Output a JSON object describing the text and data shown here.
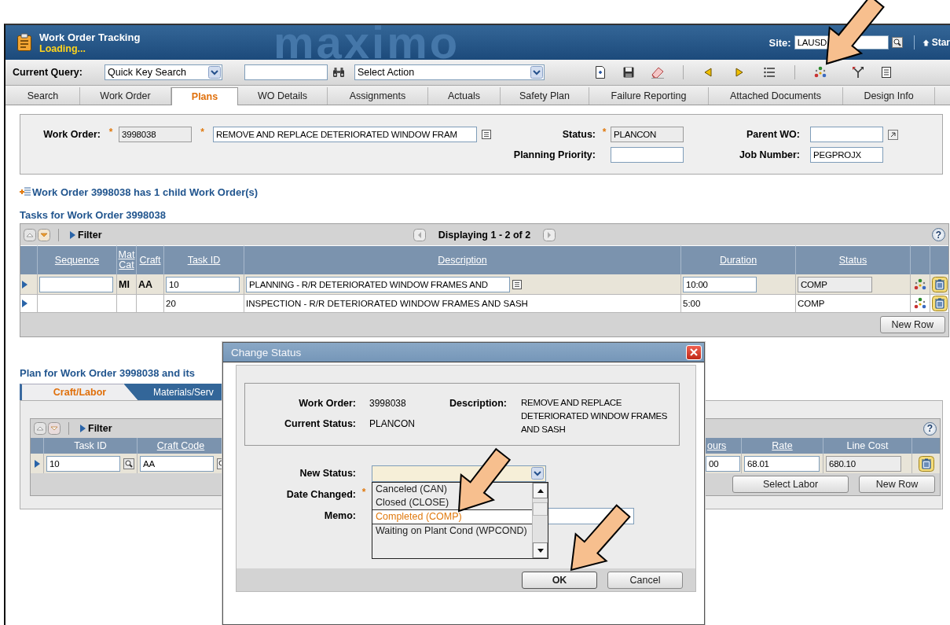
{
  "header": {
    "title": "Work Order Tracking",
    "status": "Loading...",
    "logo": "maximo",
    "site_label": "Site:",
    "site_value": "LAUSD",
    "start_link": "Star"
  },
  "toolbar": {
    "query_label": "Current Query:",
    "query_value": "Quick Key Search",
    "action_value": "Select Action"
  },
  "tabs": [
    {
      "label": "Search",
      "selected": false
    },
    {
      "label": "Work Order",
      "selected": false
    },
    {
      "label": "Plans",
      "selected": true
    },
    {
      "label": "WO Details",
      "selected": false
    },
    {
      "label": "Assignments",
      "selected": false
    },
    {
      "label": "Actuals",
      "selected": false
    },
    {
      "label": "Safety Plan",
      "selected": false
    },
    {
      "label": "Failure Reporting",
      "selected": false
    },
    {
      "label": "Attached Documents",
      "selected": false
    },
    {
      "label": "Design Info",
      "selected": false
    }
  ],
  "work_order": {
    "fields": [
      {
        "label": "Work Order:",
        "marker": "*",
        "value": "3998038",
        "readonly": true
      },
      {
        "marker": "*",
        "value": "REMOVE AND REPLACE DETERIORATED WINDOW FRAM",
        "readonly": false
      },
      {
        "label": "Status:",
        "marker": "*",
        "value": "PLANCON",
        "readonly": true
      },
      {
        "label": "Parent WO:",
        "readonly": false
      },
      {
        "label": "Planning Priority:",
        "readonly": false
      },
      {
        "label": "Job Number:",
        "value": "PEGPROJX",
        "readonly": false
      }
    ]
  },
  "child_link": "Work Order 3998038 has 1 child Work Order(s)",
  "tasks": {
    "title": "Tasks for Work Order 3998038",
    "filter": "Filter",
    "paging": "Displaying 1 - 2 of 2",
    "help": "?",
    "columns": [
      {
        "label": "Sequence",
        "link": true
      },
      {
        "label": "Mat Cat",
        "link": true
      },
      {
        "label": "Craft",
        "link": true
      },
      {
        "label": "Task ID",
        "link": true
      },
      {
        "label": "Description",
        "link": true
      },
      {
        "label": "Duration",
        "link": true
      },
      {
        "label": "Status",
        "link": true
      }
    ],
    "rows": [
      {
        "selected": true,
        "mat_cat": "MI",
        "craft": "AA",
        "task_id": "10",
        "description": "PLANNING - R/R DETERIORATED WINDOW FRAMES AND",
        "duration": "10:00",
        "status": "COMP"
      },
      {
        "selected": false,
        "task_id": "20",
        "description": "INSPECTION - R/R DETERIORATED WINDOW FRAMES AND SASH",
        "duration": "5:00",
        "status": "COMP"
      }
    ],
    "new_row": "New Row"
  },
  "plan": {
    "title": "Plan for Work Order 3998038 and its",
    "tabs": [
      {
        "label": "Craft/Labor",
        "selected": true
      },
      {
        "label": "Materials/Serv",
        "selected": false
      }
    ],
    "filter": "Filter",
    "help": "?",
    "columns": [
      {
        "label": "Task ID",
        "link": false
      },
      {
        "label": "Craft Code",
        "link": true
      },
      {
        "label": "ours",
        "link": true
      },
      {
        "label": "Rate",
        "link": true
      },
      {
        "label": "Line Cost",
        "link": false
      }
    ],
    "row": {
      "task_id": "10",
      "craft_code": "AA",
      "column_3": "00",
      "rate": "68.01",
      "line_cost": "680.10"
    },
    "buttons": [
      "Select Labor",
      "New Row"
    ]
  },
  "dialog": {
    "title": "Change Status",
    "info": [
      {
        "label": "Work Order:",
        "value": "3998038"
      },
      {
        "label": "Current Status:",
        "value": "PLANCON"
      }
    ],
    "description_label": "Description:",
    "description": "REMOVE AND REPLACE DETERIORATED WINDOW FRAMES AND SASH",
    "new_status_label": "New Status:",
    "date_label": "Date Changed:",
    "date_marker": "*",
    "memo_label": "Memo:",
    "options": [
      {
        "label": "Canceled (CAN)",
        "selected": false
      },
      {
        "label": "Closed (CLOSE)",
        "selected": false
      },
      {
        "label": "Completed (COMP)",
        "selected": true
      },
      {
        "label": "Waiting on Plant Cond (WPCOND)",
        "selected": false
      }
    ],
    "buttons": [
      {
        "label": "OK",
        "default": true
      },
      {
        "label": "Cancel",
        "default": false
      }
    ]
  }
}
